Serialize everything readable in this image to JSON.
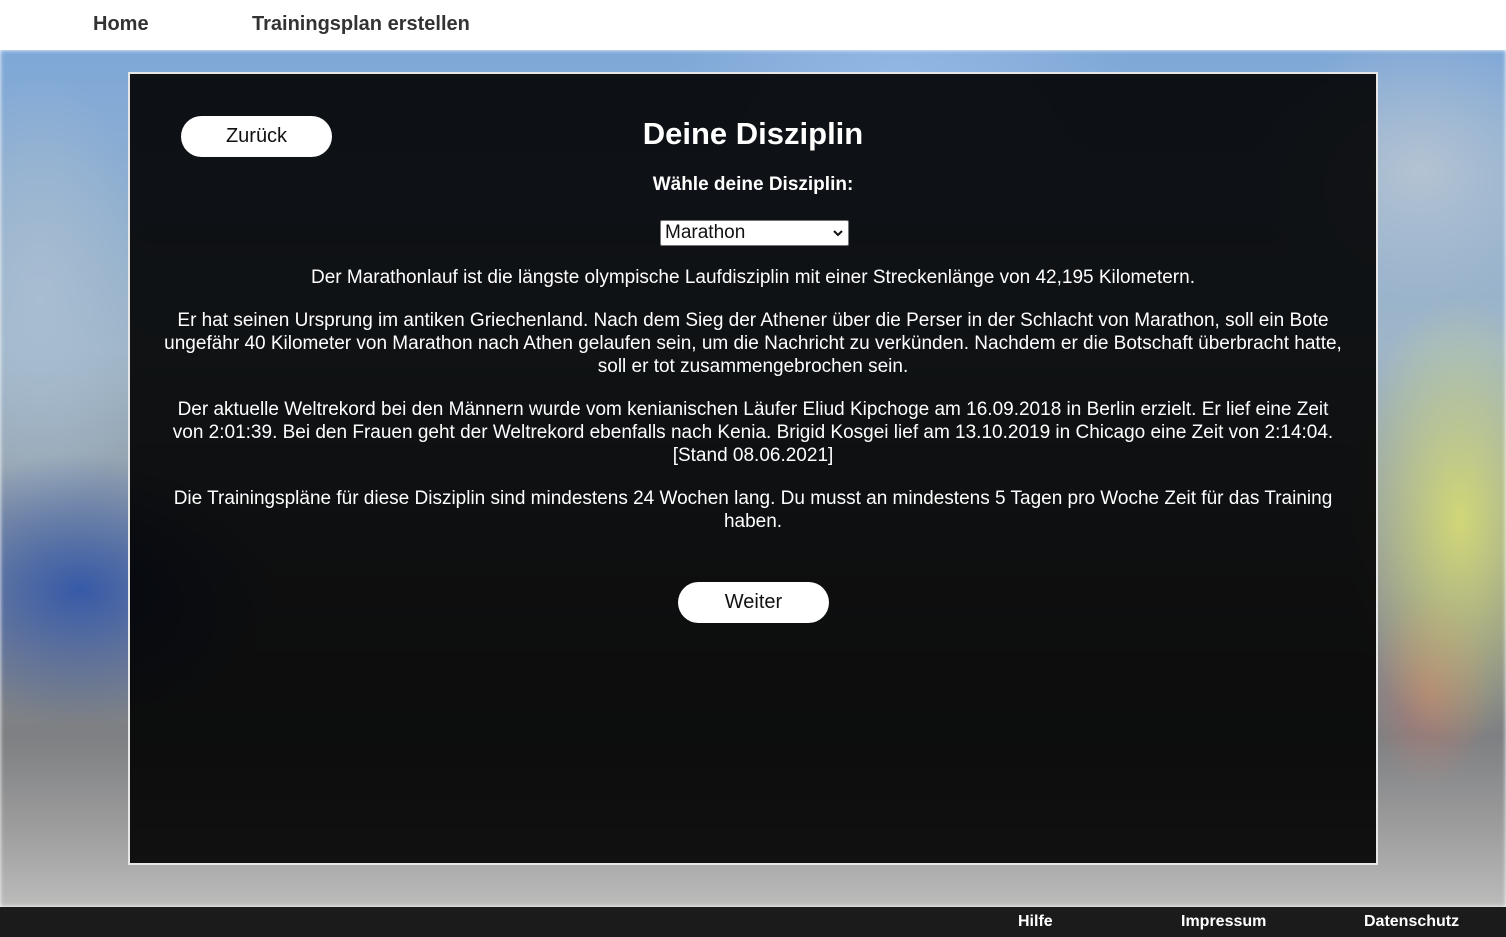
{
  "nav": {
    "home": "Home",
    "create_plan": "Trainingsplan erstellen"
  },
  "panel": {
    "back_label": "Zurück",
    "title": "Deine Disziplin",
    "subtitle": "Wähle deine Disziplin:",
    "discipline_select": {
      "selected": "Marathon"
    },
    "paragraphs": [
      "Der Marathonlauf ist die längste olympische Laufdisziplin mit einer Streckenlänge von 42,195 Kilometern.",
      "Er hat seinen Ursprung im antiken Griechenland. Nach dem Sieg der Athener über die Perser in der Schlacht von Marathon, soll ein Bote ungefähr 40 Kilometer von Marathon nach Athen gelaufen sein, um die Nachricht zu verkünden. Nachdem er die Botschaft überbracht hatte, soll er tot zusammengebrochen sein.",
      "Der aktuelle Weltrekord bei den Männern wurde vom kenianischen Läufer Eliud Kipchoge am 16.09.2018 in Berlin erzielt. Er lief eine Zeit von 2:01:39. Bei den Frauen geht der Weltrekord ebenfalls nach Kenia. Brigid Kosgei lief am 13.10.2019 in Chicago eine Zeit von 2:14:04. [Stand 08.06.2021]",
      "Die Trainingspläne für diese Disziplin sind mindestens 24 Wochen lang. Du musst an mindestens 5 Tagen pro Woche Zeit für das Training haben."
    ],
    "next_label": "Weiter"
  },
  "footer": {
    "help": "Hilfe",
    "imprint": "Impressum",
    "privacy": "Datenschutz"
  },
  "colors": {
    "panel_bg": "#000000",
    "panel_border": "#e6e6e6",
    "footer_bg": "#1b1b1b",
    "nav_text": "#333333"
  }
}
